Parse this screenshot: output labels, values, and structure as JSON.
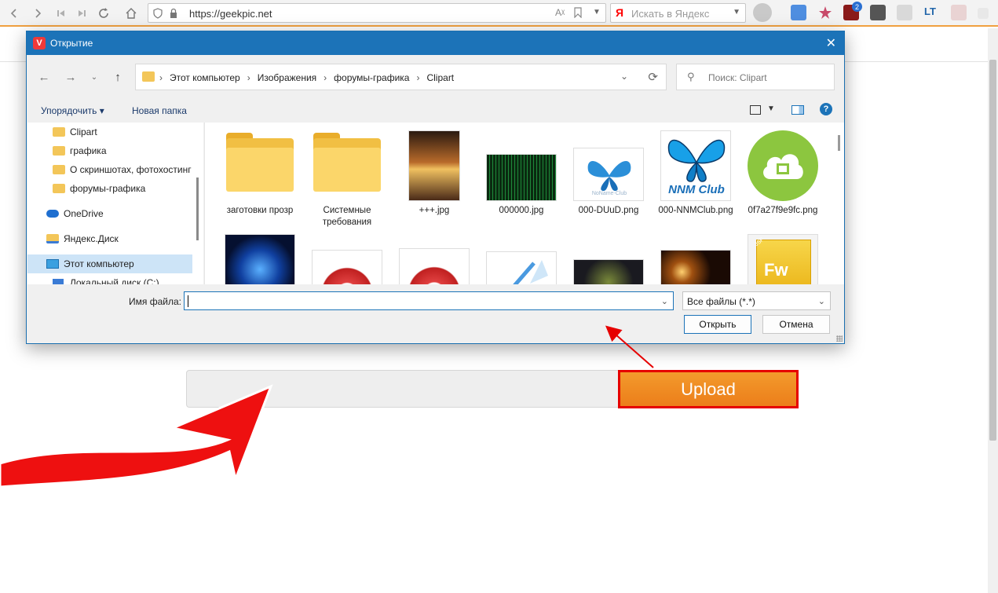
{
  "browser": {
    "url": "https://geekpic.net",
    "search_logo": "Я",
    "search_placeholder": "Искать в Яндекс",
    "badge_count": "2",
    "ext_label": "LT"
  },
  "page": {
    "upload_button": "Upload"
  },
  "dialog": {
    "app_icon": "V",
    "title": "Открытие",
    "breadcrumbs": [
      "Этот компьютер",
      "Изображения",
      "форумы-графика",
      "Clipart"
    ],
    "search_placeholder": "Поиск: Clipart",
    "organize": "Упорядочить ▾",
    "new_folder": "Новая папка",
    "help": "?",
    "nav_items": [
      {
        "label": "Clipart",
        "kind": "folder"
      },
      {
        "label": "графика",
        "kind": "folder"
      },
      {
        "label": "О скриншотах, фотохостинг",
        "kind": "folder"
      },
      {
        "label": "форумы-графика",
        "kind": "folder"
      },
      {
        "label": "OneDrive",
        "kind": "cloud"
      },
      {
        "label": "Яндекс.Диск",
        "kind": "folder"
      },
      {
        "label": "Этот компьютер",
        "kind": "pc"
      },
      {
        "label": "Локальный диск (C:)",
        "kind": "drive"
      }
    ],
    "files_row1": [
      {
        "label": "заготовки прозр"
      },
      {
        "label": "Системные требования"
      },
      {
        "label": "+++.jpg"
      },
      {
        "label": "000000.jpg"
      },
      {
        "label": "000-DUuD.png"
      },
      {
        "label": "000-NNMClub.png"
      },
      {
        "label": "0f7a27f9e9fc.png"
      }
    ],
    "thumb_texts": {
      "nnm_small": "NoName-Club",
      "nnm_big": "NNM Club",
      "fw": "Fw",
      "fw_corner": "JSF"
    },
    "filename_label": "Имя файла:",
    "filename_value": "",
    "filetype": "Все файлы (*.*)",
    "open_button": "Открыть",
    "cancel_button": "Отмена"
  },
  "colors": {
    "dialog_title_bg": "#1c73b8",
    "upload_bg": "#ee8520",
    "upload_border": "#e60000",
    "annotation_red": "#e60000"
  }
}
